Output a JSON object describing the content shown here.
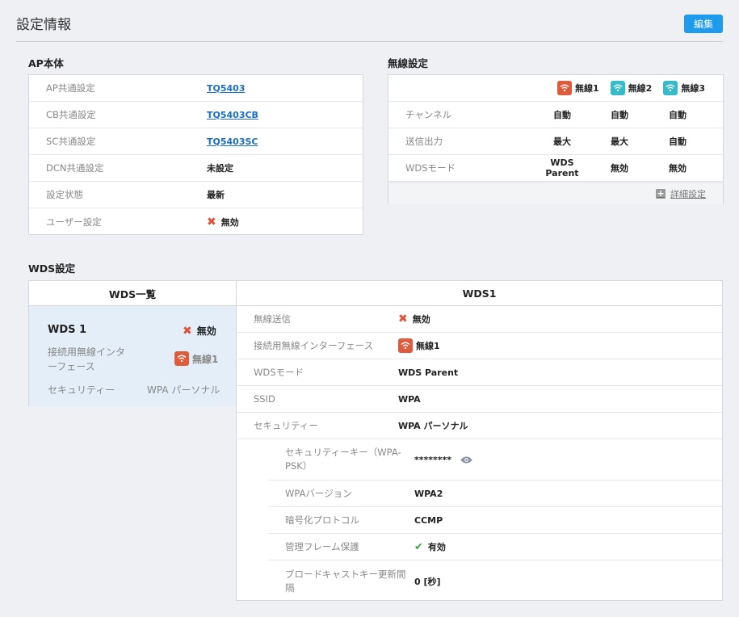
{
  "header": {
    "title": "設定情報",
    "edit_label": "編集"
  },
  "ap": {
    "title": "AP本体",
    "rows": [
      {
        "label": "AP共通設定",
        "value": "TQ5403"
      },
      {
        "label": "CB共通設定",
        "value": "TQ5403CB"
      },
      {
        "label": "SC共通設定",
        "value": "TQ5403SC"
      },
      {
        "label": "DCN共通設定",
        "value": "未設定"
      },
      {
        "label": "設定状態",
        "value": "最新"
      },
      {
        "label": "ユーザー設定",
        "value": "無効"
      }
    ]
  },
  "radio": {
    "title": "無線設定",
    "headers": [
      "無線1",
      "無線2",
      "無線3"
    ],
    "header_colors": [
      "#e05a3c",
      "#36bcc8",
      "#36bcc8"
    ],
    "rows": [
      {
        "label": "チャンネル",
        "values": [
          "自動",
          "自動",
          "自動"
        ]
      },
      {
        "label": "送信出力",
        "values": [
          "最大",
          "最大",
          "自動"
        ]
      },
      {
        "label": "WDSモード",
        "values": [
          "WDS Parent",
          "無効",
          "無効"
        ]
      }
    ],
    "detail_link": "詳細設定"
  },
  "wds": {
    "title": "WDS設定",
    "list_title": "WDS一覧",
    "card": {
      "name": "WDS 1",
      "status": "無効",
      "iface_label": "接続用無線インターフェース",
      "iface_value": "無線1",
      "security_label": "セキュリティー",
      "security_value": "WPA パーソナル"
    },
    "detail_title": "WDS1",
    "detail": {
      "tx_label": "無線送信",
      "tx_value": "無効",
      "iface_label": "接続用無線インターフェース",
      "iface_value": "無線1",
      "mode_label": "WDSモード",
      "mode_value": "WDS Parent",
      "ssid_label": "SSID",
      "ssid_value": "WPA",
      "security_label": "セキュリティー",
      "security_value": "WPA パーソナル",
      "key_label": "セキュリティーキー（WPA-PSK）",
      "key_value": "********",
      "wpa_ver_label": "WPAバージョン",
      "wpa_ver_value": "WPA2",
      "cipher_label": "暗号化プロトコル",
      "cipher_value": "CCMP",
      "pmf_label": "管理フレーム保護",
      "pmf_value": "有効",
      "rekey_label": "ブロードキャストキー更新間隔",
      "rekey_value": "0 [秒]"
    }
  },
  "icons": {
    "wifi": "wifi-icon",
    "x": "x-icon",
    "check": "check-icon",
    "eye": "eye-icon",
    "plus": "plus-icon"
  }
}
